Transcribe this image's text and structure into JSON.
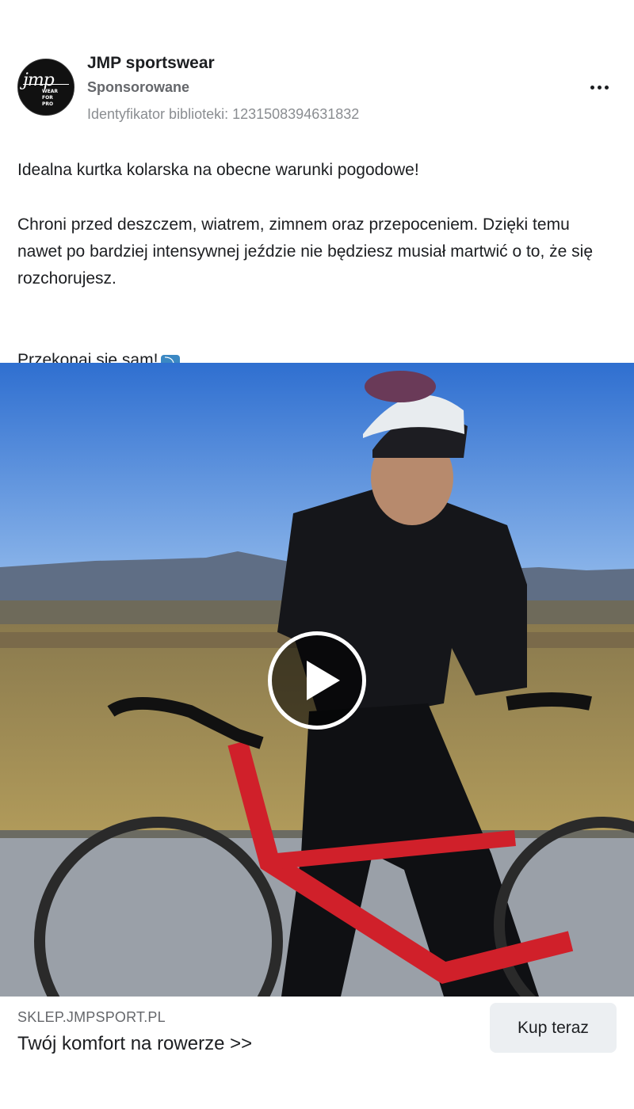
{
  "post": {
    "page_name": "JMP sportswear",
    "sponsored_label": "Sponsorowane",
    "library_id": "Identyfikator biblioteki: 1231508394631832",
    "avatar_logo": "jmp",
    "avatar_logo_tagline": "WEAR FOR PRO",
    "more_icon": "more-horizontal-icon",
    "text_line1": "Idealna kurtka kolarska na obecne warunki pogodowe!",
    "text_line2": "Chroni przed deszczem, wiatrem, zimnem oraz przepoceniem. Dzięki temu nawet po bardziej intensywnej jeździe nie będziesz musiał martwić o to, że się rozchorujesz.",
    "text_line3": "Przekonaj się sam!",
    "text_emoji": "⤵",
    "text_more": "..."
  },
  "media": {
    "type": "video",
    "play_icon": "play-icon"
  },
  "cta": {
    "domain": "SKLEP.JMPSPORT.PL",
    "headline": "Twój komfort na rowerze >>",
    "button_label": "Kup teraz"
  },
  "colors": {
    "text_primary": "#1c1e21",
    "text_secondary": "#65676b",
    "text_tertiary": "#8a8d91",
    "cta_button_bg": "#eceff2",
    "bike_red": "#d0202a"
  }
}
